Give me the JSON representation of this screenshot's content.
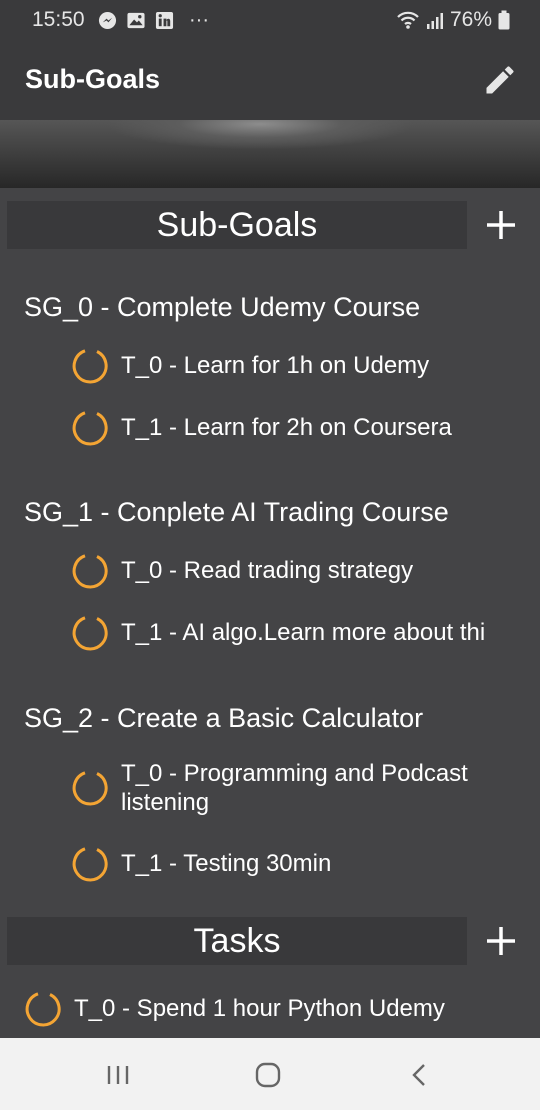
{
  "status_bar": {
    "time": "15:50",
    "battery": "76%",
    "more": "···"
  },
  "app_bar": {
    "title": "Sub-Goals"
  },
  "subgoals_section": {
    "title": "Sub-Goals"
  },
  "subgoals": [
    {
      "title": "SG_0  -  Complete Udemy Course",
      "tasks": [
        "T_0  -  Learn for 1h on Udemy",
        "T_1  -  Learn for 2h on Coursera"
      ]
    },
    {
      "title": "SG_1  -  Conplete AI Trading Course",
      "tasks": [
        "T_0  -  Read trading strategy",
        "T_1  -  AI algo.Learn more about thi"
      ]
    },
    {
      "title": "SG_2  -  Create a Basic Calculator",
      "tasks": [
        "T_0  -  Programming and Podcast\nlistening",
        "T_1  -  Testing 30min"
      ]
    }
  ],
  "tasks_section": {
    "title": "Tasks"
  },
  "tasks": [
    "T_0  -  Spend 1 hour Python Udemy"
  ],
  "colors": {
    "accent": "#f4a534",
    "background": "#444446",
    "header": "#39393b"
  }
}
